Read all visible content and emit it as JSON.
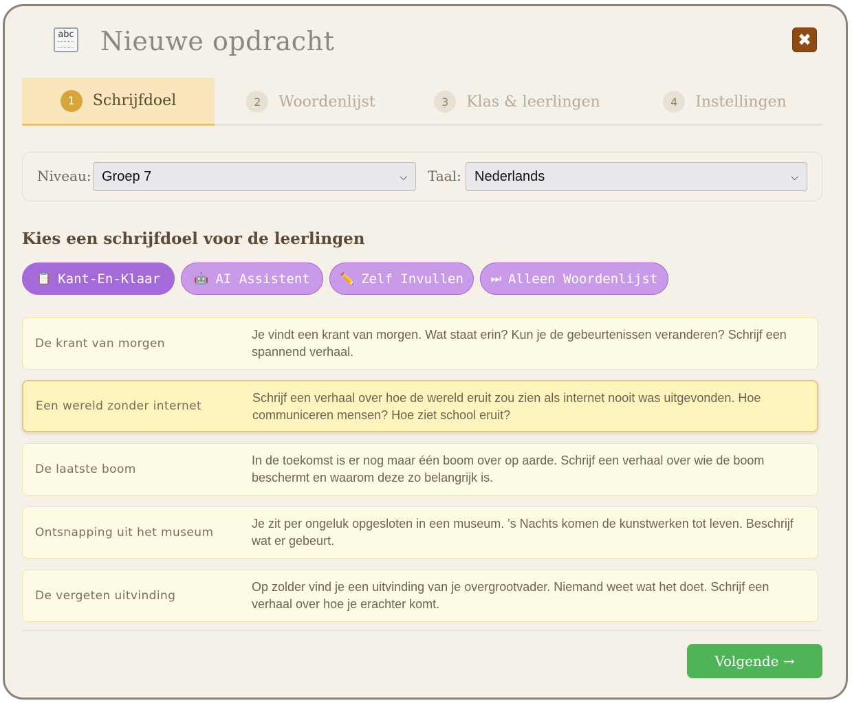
{
  "header": {
    "icon_text": "abc",
    "title": "Nieuwe opdracht",
    "close_symbol": "✖"
  },
  "tabs": [
    {
      "number": "1",
      "label": "Schrijfdoel",
      "active": true
    },
    {
      "number": "2",
      "label": "Woordenlijst",
      "active": false
    },
    {
      "number": "3",
      "label": "Klas & leerlingen",
      "active": false
    },
    {
      "number": "4",
      "label": "Instellingen",
      "active": false
    }
  ],
  "filters": {
    "niveau_label": "Niveau:",
    "niveau_value": "Groep 7",
    "taal_label": "Taal:",
    "taal_value": "Nederlands"
  },
  "section_heading": "Kies een schrijfdoel voor de leerlingen",
  "modes": [
    {
      "icon": "clipboard-icon",
      "glyph": "📋",
      "label": "Kant-En-Klaar",
      "active": true
    },
    {
      "icon": "robot-icon",
      "glyph": "🤖",
      "label": "AI Assistent",
      "active": false
    },
    {
      "icon": "pencil-icon",
      "glyph": "✏️",
      "label": "Zelf Invullen",
      "active": false
    },
    {
      "icon": "fast-forward-icon",
      "glyph": "⏭",
      "label": "Alleen Woordenlijst",
      "active": false
    }
  ],
  "goals": [
    {
      "title": "De krant van morgen",
      "description": "Je vindt een krant van morgen. Wat staat erin? Kun je de gebeurtenissen veranderen? Schrijf een spannend verhaal.",
      "selected": false
    },
    {
      "title": "Een wereld zonder internet",
      "description": "Schrijf een verhaal over hoe de wereld eruit zou zien als internet nooit was uitgevonden. Hoe communiceren mensen? Hoe ziet school eruit?",
      "selected": true
    },
    {
      "title": "De laatste boom",
      "description": "In de toekomst is er nog maar één boom over op aarde. Schrijf een verhaal over wie de boom beschermt en waarom deze zo belangrijk is.",
      "selected": false
    },
    {
      "title": "Ontsnapping uit het museum",
      "description": "Je zit per ongeluk opgesloten in een museum. 's Nachts komen de kunstwerken tot leven. Beschrijf wat er gebeurt.",
      "selected": false
    },
    {
      "title": "De vergeten uitvinding",
      "description": "Op zolder vind je een uitvinding van je overgrootvader. Niemand weet wat het doet. Schrijf een verhaal over hoe je erachter komt.",
      "selected": false
    }
  ],
  "footer": {
    "next_label": "Volgende →"
  },
  "colors": {
    "background": "#f5f1e9",
    "accent_purple": "#a56ad9",
    "next_green": "#4fb458",
    "close_brown": "#8e4b13",
    "active_tab": "#f9e6bd"
  }
}
